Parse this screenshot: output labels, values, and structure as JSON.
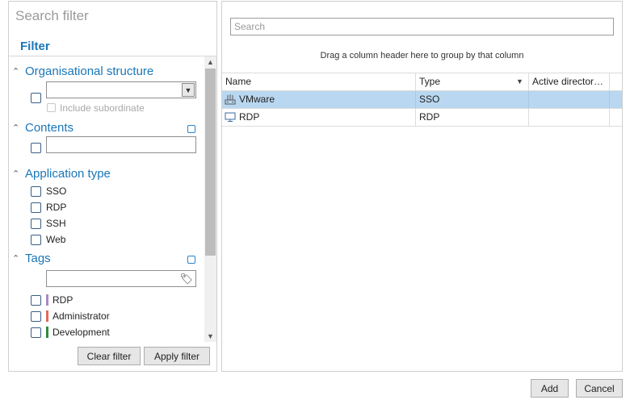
{
  "filter_panel": {
    "search_placeholder": "Search filter",
    "heading": "Filter",
    "sections": {
      "org": {
        "title": "Organisational structure",
        "include_subordinate": "Include subordinate"
      },
      "contents": {
        "title": "Contents"
      },
      "app_type": {
        "title": "Application type",
        "options": [
          "SSO",
          "RDP",
          "SSH",
          "Web"
        ]
      },
      "tags": {
        "title": "Tags",
        "items": [
          {
            "label": "RDP",
            "color": "#a78bc4"
          },
          {
            "label": "Administrator",
            "color": "#e06a5a"
          },
          {
            "label": "Development",
            "color": "#2e8b3a"
          }
        ]
      }
    },
    "clear_filter": "Clear filter",
    "apply_filter": "Apply filter"
  },
  "grid_panel": {
    "search_placeholder": "Search",
    "group_hint": "Drag a column header here to group by that column",
    "columns": [
      "Name",
      "Type",
      "Active director…"
    ],
    "rows": [
      {
        "name": "VMware",
        "type": "SSO",
        "icon": "sso-app-icon",
        "selected": true
      },
      {
        "name": "RDP",
        "type": "RDP",
        "icon": "monitor-icon",
        "selected": false
      }
    ],
    "selection_color": "#b9d7f0"
  },
  "footer": {
    "add": "Add",
    "cancel": "Cancel"
  }
}
